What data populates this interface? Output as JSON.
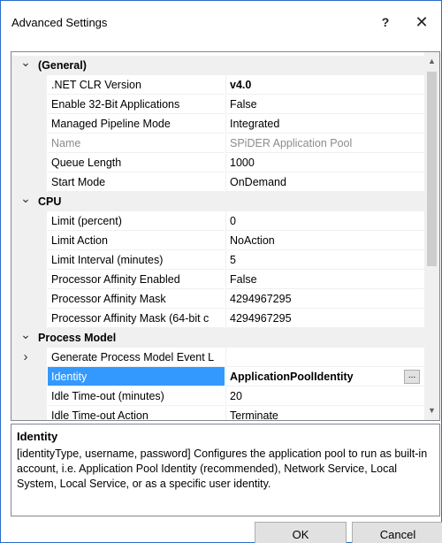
{
  "window": {
    "title": "Advanced Settings",
    "help_label": "?",
    "close_label": "✕"
  },
  "grid": {
    "rows": [
      {
        "type": "category",
        "label": "(General)"
      },
      {
        "type": "property",
        "name": ".NET CLR Version",
        "value": "v4.0",
        "bold": true
      },
      {
        "type": "property",
        "name": "Enable 32-Bit Applications",
        "value": "False"
      },
      {
        "type": "property",
        "name": "Managed Pipeline Mode",
        "value": "Integrated"
      },
      {
        "type": "property",
        "name": "Name",
        "value": "SPiDER Application Pool",
        "disabled": true
      },
      {
        "type": "property",
        "name": "Queue Length",
        "value": "1000"
      },
      {
        "type": "property",
        "name": "Start Mode",
        "value": "OnDemand"
      },
      {
        "type": "category",
        "label": "CPU"
      },
      {
        "type": "property",
        "name": "Limit (percent)",
        "value": "0"
      },
      {
        "type": "property",
        "name": "Limit Action",
        "value": "NoAction"
      },
      {
        "type": "property",
        "name": "Limit Interval (minutes)",
        "value": "5"
      },
      {
        "type": "property",
        "name": "Processor Affinity Enabled",
        "value": "False"
      },
      {
        "type": "property",
        "name": "Processor Affinity Mask",
        "value": "4294967295"
      },
      {
        "type": "property",
        "name": "Processor Affinity Mask (64-bit c",
        "value": "4294967295"
      },
      {
        "type": "category",
        "label": "Process Model"
      },
      {
        "type": "property",
        "name": "Generate Process Model Event L",
        "value": "",
        "expandable": true
      },
      {
        "type": "property",
        "name": "Identity",
        "value": "ApplicationPoolIdentity",
        "selected": true,
        "ellipsis": "..."
      },
      {
        "type": "property",
        "name": "Idle Time-out (minutes)",
        "value": "20"
      },
      {
        "type": "property",
        "name": "Idle Time-out Action",
        "value": "Terminate"
      }
    ]
  },
  "description": {
    "title": "Identity",
    "text": "[identityType, username, password] Configures the application pool to run as built-in account, i.e. Application Pool Identity (recommended), Network Service, Local System, Local Service, or as a specific user identity."
  },
  "buttons": {
    "ok": "OK",
    "cancel": "Cancel"
  },
  "icons": {
    "collapse": "chevron-down-icon",
    "expand": "chevron-right-icon"
  }
}
